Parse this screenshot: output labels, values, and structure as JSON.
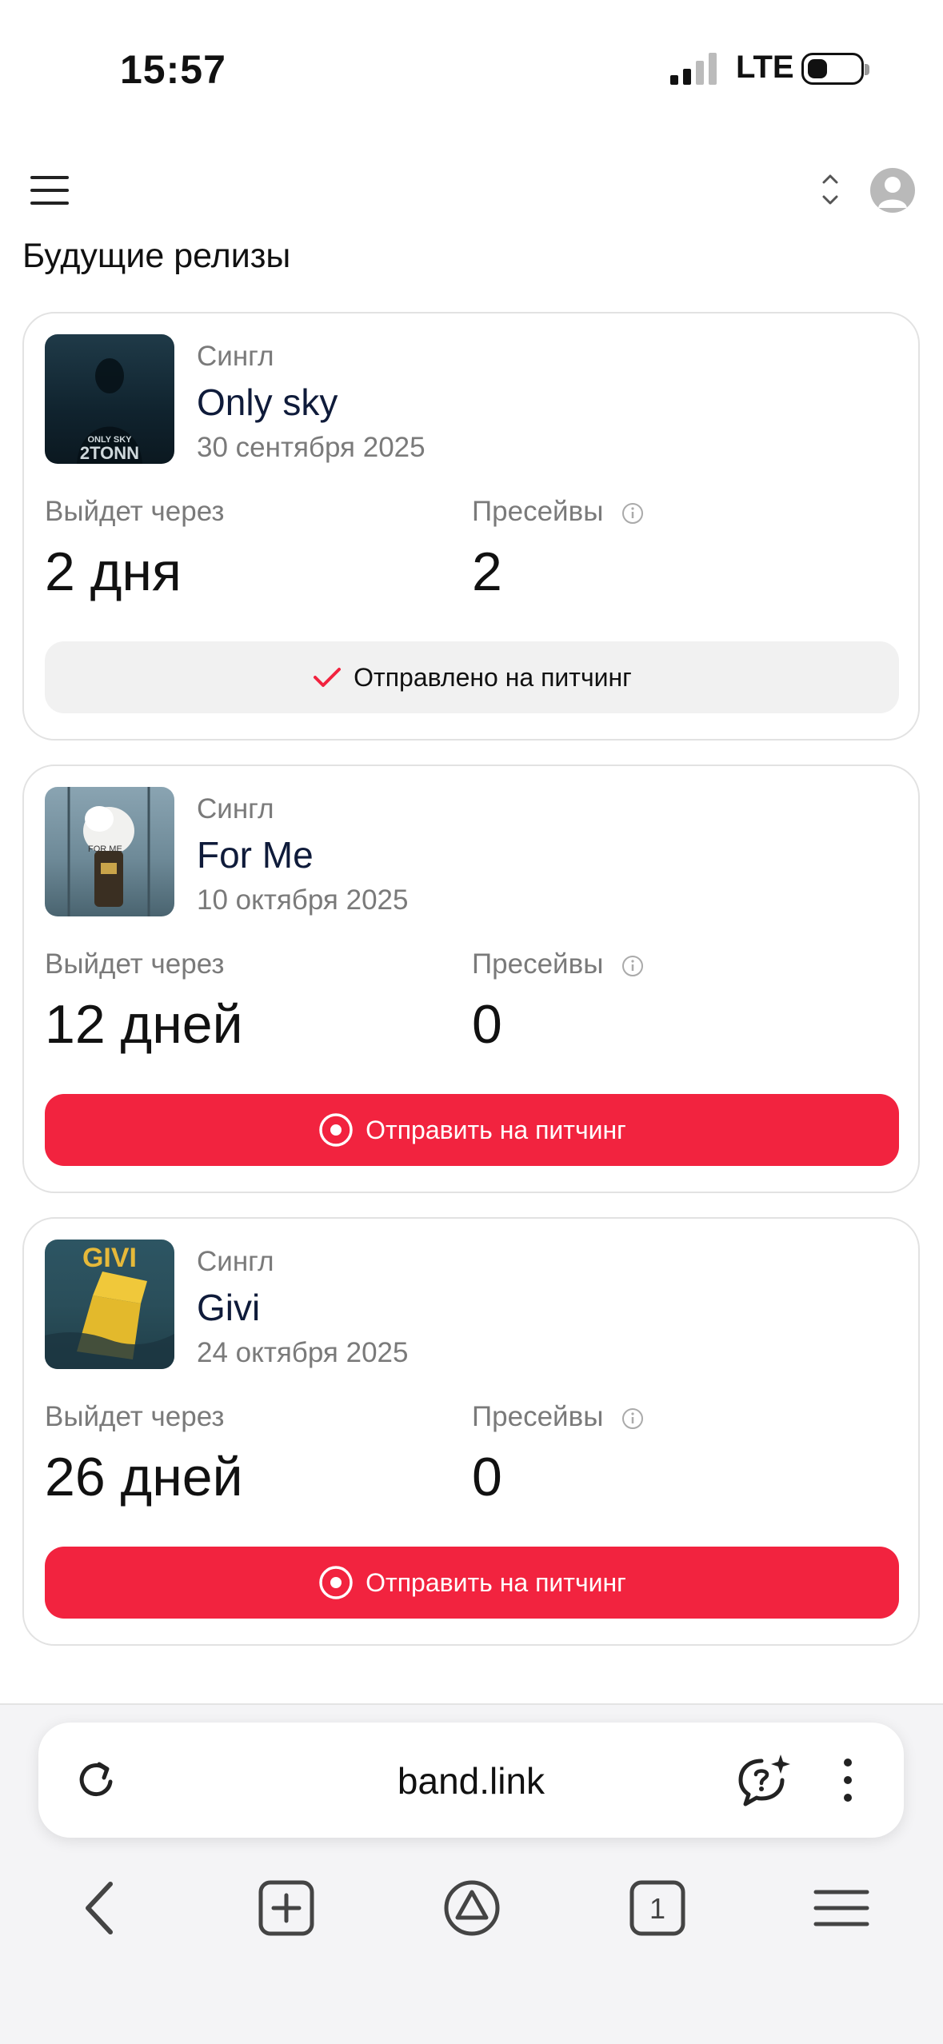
{
  "status_bar": {
    "time": "15:57",
    "network": "LTE"
  },
  "page": {
    "title": "Будущие релизы"
  },
  "releases": [
    {
      "type": "Сингл",
      "title": "Only sky",
      "date": "30 сентября 2025",
      "cover_caption_top": "ONLY SKY",
      "cover_caption_bottom": "2TONN",
      "release_label": "Выйдет через",
      "release_in": "2 дня",
      "presaves_label": "Пресейвы",
      "presaves": "2",
      "button_label": "Отправлено на питчинг",
      "button_state": "sent"
    },
    {
      "type": "Сингл",
      "title": "For Me",
      "date": "10 октября 2025",
      "cover_caption_top": "FOR ME",
      "release_label": "Выйдет через",
      "release_in": "12 дней",
      "presaves_label": "Пресейвы",
      "presaves": "0",
      "button_label": "Отправить на питчинг",
      "button_state": "send"
    },
    {
      "type": "Сингл",
      "title": "Givi",
      "date": "24 октября 2025",
      "cover_caption_top": "GIVI",
      "release_label": "Выйдет через",
      "release_in": "26 дней",
      "presaves_label": "Пресейвы",
      "presaves": "0",
      "button_label": "Отправить на питчинг",
      "button_state": "send"
    }
  ],
  "browser": {
    "url": "band.link",
    "tabs_count": "1"
  },
  "colors": {
    "accent_red": "#f2233f",
    "sent_bg": "#f1f1f1",
    "title_navy": "#0f1b3a"
  }
}
